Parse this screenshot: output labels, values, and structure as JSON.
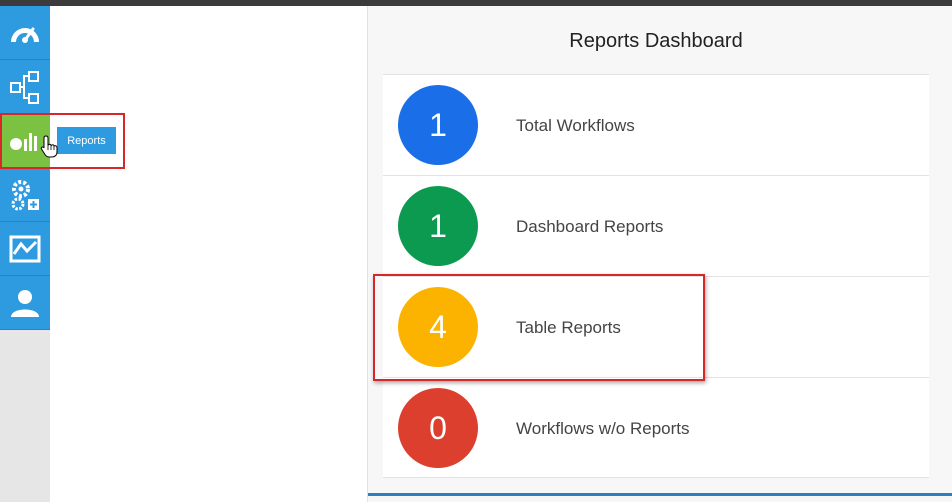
{
  "tooltip": {
    "text": "Reports"
  },
  "sidebar": {
    "items": [
      {
        "icon": "speedometer-icon",
        "active": false
      },
      {
        "icon": "workflow-icon",
        "active": false
      },
      {
        "icon": "reports-chart-icon",
        "active": true
      },
      {
        "icon": "gears-add-icon",
        "active": false
      },
      {
        "icon": "line-chart-icon",
        "active": false
      },
      {
        "icon": "user-icon",
        "active": false
      }
    ]
  },
  "panel": {
    "title": "Reports Dashboard",
    "rows": [
      {
        "count": "1",
        "label": "Total Workflows",
        "color": "#1a6fe8"
      },
      {
        "count": "1",
        "label": "Dashboard Reports",
        "color": "#0c9a50"
      },
      {
        "count": "4",
        "label": "Table Reports",
        "color": "#fbb300"
      },
      {
        "count": "0",
        "label": "Workflows w/o Reports",
        "color": "#dc3f2e"
      }
    ]
  },
  "colors": {
    "sidebar": "#2e9be0",
    "sidebar_active": "#7bc142",
    "highlight": "#d9262b"
  }
}
